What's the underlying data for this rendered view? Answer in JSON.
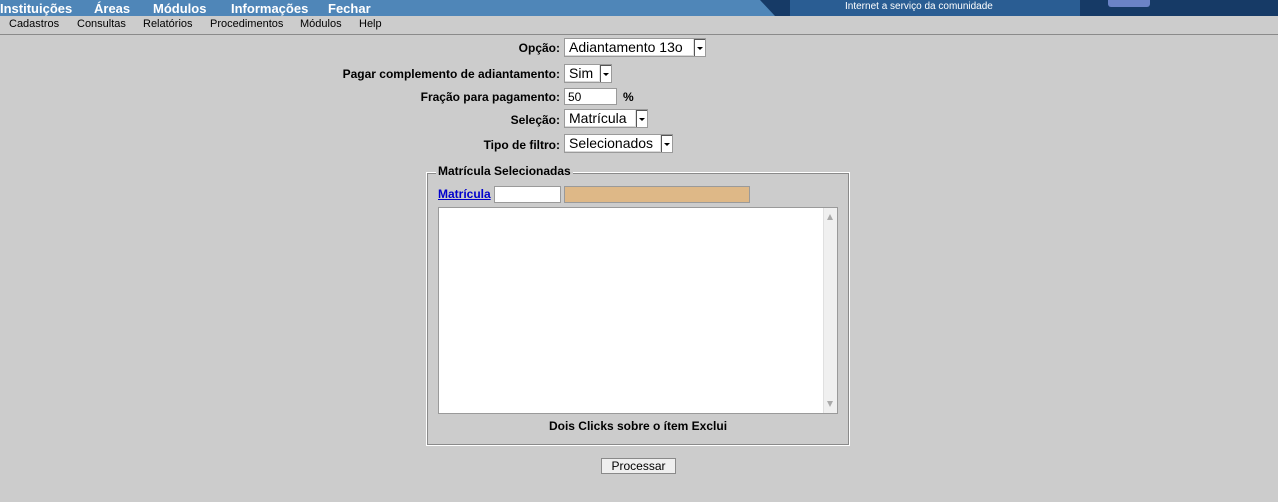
{
  "top_menu": [
    "Instituições",
    "Áreas",
    "Módulos",
    "Informações",
    "Fechar"
  ],
  "banner_text": "Internet a serviço da comunidade",
  "menu": [
    "Cadastros",
    "Consultas",
    "Relatórios",
    "Procedimentos",
    "Módulos",
    "Help"
  ],
  "form": {
    "opcao": {
      "label": "Opção:",
      "value": "Adiantamento 13o"
    },
    "complemento": {
      "label": "Pagar complemento de adiantamento:",
      "value": "Sim"
    },
    "fracao": {
      "label": "Fração para pagamento:",
      "value": "50",
      "unit": "%"
    },
    "selecao": {
      "label": "Seleção:",
      "value": "Matrícula"
    },
    "tipo_filtro": {
      "label": "Tipo de filtro:",
      "value": "Selecionados"
    }
  },
  "fieldset": {
    "legend": "Matrícula Selecionadas",
    "link": "Matrícula",
    "matricula_value": "",
    "hint": "Dois Clicks sobre o ítem Exclui"
  },
  "process_button": "Processar",
  "colors": {
    "banner": "#4f86b8",
    "banner_dark": "#163a66",
    "name_field": "#deb887"
  }
}
